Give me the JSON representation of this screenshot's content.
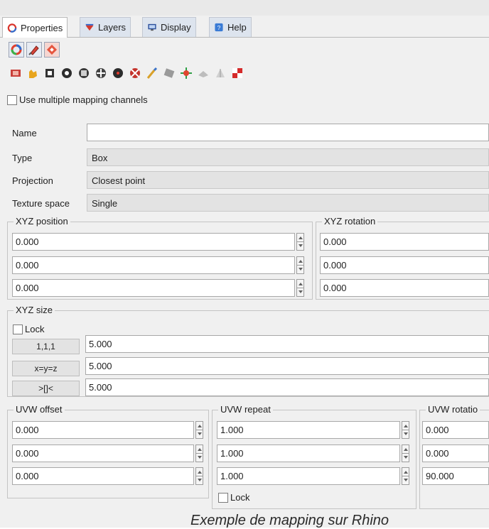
{
  "tabs": [
    {
      "label": "Properties",
      "icon": "properties-icon"
    },
    {
      "label": "Layers",
      "icon": "layers-icon"
    },
    {
      "label": "Display",
      "icon": "display-icon"
    },
    {
      "label": "Help",
      "icon": "help-icon"
    }
  ],
  "mapping_channels_label": "Use multiple mapping channels",
  "props": {
    "name_label": "Name",
    "name_value": "",
    "type_label": "Type",
    "type_value": "Box",
    "projection_label": "Projection",
    "projection_value": "Closest point",
    "texture_space_label": "Texture space",
    "texture_space_value": "Single"
  },
  "xyz_position": {
    "title": "XYZ position",
    "values": [
      "0.000",
      "0.000",
      "0.000"
    ]
  },
  "xyz_rotation": {
    "title": "XYZ rotation",
    "values": [
      "0.000",
      "0.000",
      "0.000"
    ]
  },
  "xyz_size": {
    "title": "XYZ size",
    "lock_label": "Lock",
    "buttons": [
      "1,1,1",
      "x=y=z",
      ">[]<"
    ],
    "values": [
      "5.000",
      "5.000",
      "5.000"
    ]
  },
  "uvw_offset": {
    "title": "UVW offset",
    "values": [
      "0.000",
      "0.000",
      "0.000"
    ]
  },
  "uvw_repeat": {
    "title": "UVW repeat",
    "values": [
      "1.000",
      "1.000",
      "1.000"
    ],
    "lock_label": "Lock"
  },
  "uvw_rotation": {
    "title": "UVW rotatio",
    "values": [
      "0.000",
      "0.000",
      "90.000"
    ]
  },
  "caption": "Exemple de mapping sur Rhino",
  "colors": {
    "accent": "#3b6fc4",
    "panel": "#f0f0f0",
    "readonly": "#e3e3e3"
  }
}
